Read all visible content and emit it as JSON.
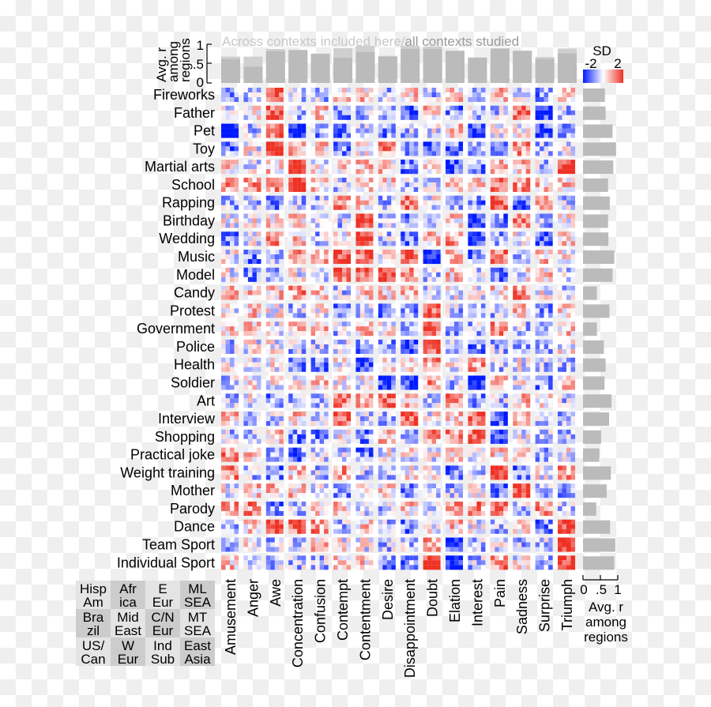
{
  "chart_data": {
    "type": "heatmap",
    "title": "Across contexts included here/all contexts studied",
    "title_parts": {
      "light": "Across contexts included here/",
      "dark": "all contexts studied"
    },
    "top_axis": {
      "label_lines": [
        "Avg. r",
        "among",
        "regions"
      ],
      "ticks": [
        "0",
        ".5",
        "1"
      ],
      "range": [
        0,
        1
      ]
    },
    "right_axis": {
      "label_lines": [
        "Avg. r",
        "among",
        "regions"
      ],
      "ticks": [
        "0",
        ".5",
        "1"
      ],
      "range": [
        0,
        1
      ]
    },
    "color_scale": {
      "label": "SD",
      "min_label": "-2",
      "max_label": "2",
      "range": [
        -2,
        2
      ],
      "low_color": "#0019ff",
      "mid_color": "#ffffff",
      "high_color": "#ee3124"
    },
    "regions_legend": [
      [
        "Hisp\nAm",
        "Afr\nica",
        "E\nEur",
        "ML\nSEA"
      ],
      [
        "Bra\nzil",
        "Mid\nEast",
        "C/N\nEur",
        "MT\nSEA"
      ],
      [
        "US/\nCan",
        "W\nEur",
        "Ind\nSub",
        "East\nAsia"
      ]
    ],
    "emotions": [
      "Amusement",
      "Anger",
      "Awe",
      "Concentration",
      "Confusion",
      "Contempt",
      "Contentment",
      "Desire",
      "Disappointment",
      "Doubt",
      "Elation",
      "Interest",
      "Pain",
      "Sadness",
      "Surprise",
      "Triumph"
    ],
    "contexts": [
      "Fireworks",
      "Father",
      "Pet",
      "Toy",
      "Martial arts",
      "School",
      "Rapping",
      "Birthday",
      "Wedding",
      "Music",
      "Model",
      "Candy",
      "Protest",
      "Government",
      "Police",
      "Health",
      "Soldier",
      "Art",
      "Interview",
      "Shopping",
      "Practical joke",
      "Weight training",
      "Mother",
      "Parody",
      "Dance",
      "Team Sport",
      "Individual Sport"
    ],
    "emotion_avg_r_included": [
      0.62,
      0.42,
      0.82,
      0.84,
      0.75,
      0.65,
      0.8,
      0.68,
      0.88,
      0.88,
      0.82,
      0.65,
      0.88,
      0.82,
      0.62,
      0.76
    ],
    "emotion_avg_r_all": [
      0.68,
      0.68,
      0.88,
      0.86,
      0.76,
      0.9,
      0.96,
      0.7,
      0.96,
      0.94,
      0.84,
      0.66,
      0.9,
      0.84,
      0.67,
      0.89
    ],
    "context_avg_r": [
      0.63,
      0.65,
      0.85,
      0.95,
      0.87,
      0.72,
      0.77,
      0.72,
      0.73,
      0.9,
      0.85,
      0.4,
      0.76,
      0.4,
      0.6,
      0.65,
      0.62,
      0.82,
      0.75,
      0.52,
      0.47,
      0.8,
      0.68,
      0.38,
      0.78,
      0.93,
      0.9
    ],
    "cell_mean_sd": [
      [
        -1,
        -0.5,
        1.5,
        -0.5,
        -0.5,
        0.5,
        0.5,
        -0.5,
        0.5,
        -0.5,
        0.5,
        -0.5,
        0.5,
        0,
        -1,
        0.5
      ],
      [
        0,
        0,
        1.5,
        -0.5,
        0.5,
        -1,
        -0.5,
        -0.5,
        -1.5,
        0.5,
        -1,
        -0.5,
        -0.5,
        1.5,
        -1.5,
        -0.5
      ],
      [
        -2,
        -0.5,
        1.5,
        -2,
        -1,
        -1,
        -0.5,
        -1,
        -0.5,
        0,
        0.5,
        -1.5,
        0,
        0,
        -1.5,
        -1
      ],
      [
        -1,
        0,
        2,
        0.5,
        0.5,
        -1,
        0,
        1,
        -1,
        -1.5,
        -1,
        -0.5,
        -1,
        1,
        -0.5,
        0
      ],
      [
        0.5,
        0,
        0.5,
        2,
        0,
        0.5,
        0.5,
        0.5,
        -1,
        0.5,
        -1.5,
        -1,
        0.5,
        0.5,
        -0.5,
        2
      ],
      [
        1,
        1,
        1,
        2,
        0.5,
        -0.5,
        0.5,
        0.5,
        -0.5,
        -0.5,
        0.5,
        0.5,
        1,
        1,
        0.5,
        0.5
      ],
      [
        -0.5,
        -0.5,
        -1,
        -0.5,
        -0.5,
        1,
        0.5,
        -0.5,
        1.5,
        0,
        -0.5,
        -1,
        1.5,
        -1.5,
        1,
        -0.5
      ],
      [
        0,
        0,
        0.5,
        0.5,
        -0.5,
        -0.5,
        2,
        -0.5,
        -1,
        -0.5,
        0.5,
        -1.5,
        -1,
        1,
        -0.5,
        0
      ],
      [
        -1,
        0,
        1,
        0.5,
        -0.5,
        0,
        2,
        -0.5,
        -1,
        0.5,
        1,
        -1.5,
        -1,
        0,
        -1.5,
        0.5
      ],
      [
        0,
        -1,
        -0.5,
        1,
        1,
        1.5,
        1.5,
        0,
        1.5,
        -2,
        0.5,
        -1,
        1.5,
        -0.5,
        0.5,
        0
      ],
      [
        0,
        -1,
        -0.5,
        0,
        -0.5,
        1.5,
        1.5,
        2,
        1,
        -0.5,
        0.5,
        -0.5,
        -1,
        0,
        0.5,
        -0.5
      ],
      [
        0.5,
        0.5,
        0.5,
        1,
        0.5,
        -0.5,
        0.5,
        0.5,
        0.5,
        -0.5,
        0,
        0,
        0.5,
        1,
        0,
        -0.5
      ],
      [
        0,
        0.5,
        0,
        -0.5,
        0,
        -1,
        -0.5,
        -1,
        -1,
        1.5,
        -0.5,
        -1,
        -0.5,
        0.5,
        -1,
        0.5
      ],
      [
        0.5,
        0.5,
        0,
        0.5,
        0.5,
        -0.5,
        0.5,
        0,
        -0.5,
        1.5,
        -1,
        -0.5,
        1,
        -0.5,
        -0.5,
        0.5
      ],
      [
        -0.5,
        0,
        0,
        -0.5,
        -0.5,
        -0.5,
        -1,
        -1,
        -1.5,
        1.5,
        -0.5,
        -1,
        -0.5,
        -0.5,
        -0.5,
        0
      ],
      [
        0,
        -0.5,
        0,
        -1,
        -1,
        0,
        -1.5,
        0,
        0,
        1,
        0,
        1,
        -0.5,
        0,
        -0.5,
        -0.5
      ],
      [
        -0.5,
        0,
        0,
        0,
        0.5,
        0,
        0,
        -1.5,
        -1.5,
        1,
        -0.5,
        -2,
        0.5,
        0,
        -1,
        0.5
      ],
      [
        -0.5,
        0,
        -1,
        -0.5,
        -0.5,
        1,
        1,
        1.5,
        0.5,
        -0.5,
        1,
        -1,
        -0.5,
        0.5,
        0.5,
        -0.5
      ],
      [
        0.5,
        -0.5,
        -0.5,
        0.5,
        -0.5,
        1.5,
        -0.5,
        -0.5,
        1.5,
        0,
        0.5,
        1.5,
        -1.5,
        0.5,
        -0.5,
        -0.5
      ],
      [
        -0.5,
        -0.5,
        0.5,
        -1,
        -1,
        0,
        -1,
        0.5,
        -0.5,
        1,
        1,
        1.5,
        -1.5,
        0,
        -0.5,
        -0.5
      ],
      [
        1,
        0.5,
        -0.5,
        -1,
        -0.5,
        -0.5,
        -1,
        0,
        0,
        0,
        0.5,
        0,
        0.5,
        0,
        -0.5,
        0
      ],
      [
        1,
        -0.5,
        -1,
        0.5,
        -0.5,
        1,
        -0.5,
        -0.5,
        0,
        0,
        -1,
        -0.5,
        2,
        -1,
        0,
        1
      ],
      [
        0,
        0.5,
        0.5,
        0.5,
        0,
        -1,
        0.5,
        0.5,
        -1,
        -0.5,
        -0.5,
        0,
        -1,
        2,
        -0.5,
        -1
      ],
      [
        1,
        1,
        -1,
        -0.5,
        0.5,
        0.5,
        -0.5,
        -0.5,
        0.5,
        -0.5,
        1,
        1,
        1,
        -0.5,
        1,
        -0.5
      ],
      [
        -0.5,
        0.5,
        2,
        1.5,
        1,
        -0.5,
        0.5,
        -0.5,
        -1,
        0,
        0.5,
        0,
        -0.5,
        0,
        -1,
        2
      ],
      [
        -0.5,
        0,
        -0.5,
        -0.5,
        0.5,
        0,
        0,
        -0.5,
        -0.5,
        1,
        -1.5,
        -0.5,
        0,
        -0.5,
        -0.5,
        2
      ],
      [
        0.5,
        -0.5,
        -0.5,
        -0.5,
        -0.5,
        0.5,
        0.5,
        -1,
        -1,
        2,
        -2,
        -0.5,
        1,
        0,
        -0.5,
        2
      ]
    ]
  }
}
